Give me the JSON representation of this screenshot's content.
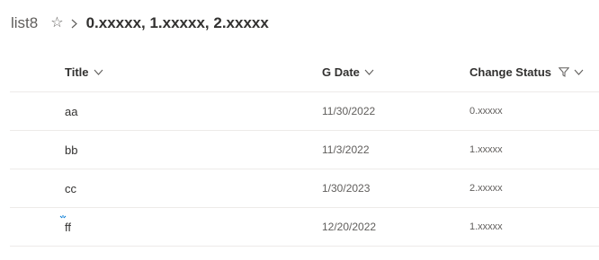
{
  "breadcrumb": {
    "list_name": "list8",
    "view_name": "0.xxxxx, 1.xxxxx, 2.xxxxx"
  },
  "icons": {
    "favorite": "star-outline-icon",
    "separator": "chevron-right-icon",
    "sort": "chevron-down-icon",
    "filter": "filter-icon",
    "new_item": "new-item-sparkle-icon"
  },
  "columns": [
    {
      "label": "Title"
    },
    {
      "label": "G Date"
    },
    {
      "label": "Change Status"
    }
  ],
  "rows": [
    {
      "title": "aa",
      "date": "11/30/2022",
      "status": "0.xxxxx"
    },
    {
      "title": "bb",
      "date": "11/3/2022",
      "status": "1.xxxxx"
    },
    {
      "title": "cc",
      "date": "1/30/2023",
      "status": "2.xxxxx"
    },
    {
      "title": "ff",
      "date": "12/20/2022",
      "status": "1.xxxxx",
      "is_new": true
    }
  ],
  "colors": {
    "text": "#323130",
    "secondary_text": "#605e5c",
    "divider": "#edebe9"
  }
}
